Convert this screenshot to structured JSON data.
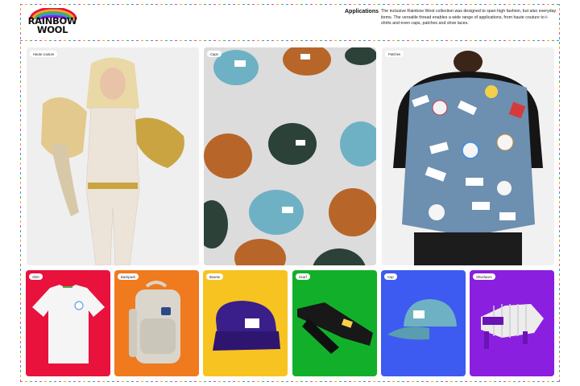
{
  "brand": {
    "line1": "RAINBOW",
    "line2": "WOOL"
  },
  "header": {
    "title": "Applications",
    "description": "The inclusive Rainbow Wool collection was designed to span high fashion, but also everyday items. The versatile thread enables a wide range of applications, from haute couture to t-shirts and even caps, patches and shoe laces."
  },
  "gallery_top": [
    {
      "label": "Haute couture"
    },
    {
      "label": "Caps"
    },
    {
      "label": "Patches"
    }
  ],
  "gallery_bottom": [
    {
      "label": "Shirt"
    },
    {
      "label": "Backpack"
    },
    {
      "label": "Beanie"
    },
    {
      "label": "Scarf"
    },
    {
      "label": "Cap"
    },
    {
      "label": "Shoelaces"
    }
  ],
  "colors": {
    "shirt_bg": "#e8123c",
    "backpack_bg": "#f07a1e",
    "beanie_bg": "#f7c321",
    "scarf_bg": "#12b02a",
    "cap_bg": "#3d5bf0",
    "shoelaces_bg": "#8a1fe0",
    "rainbow": [
      "#e94b8a",
      "#f5a623",
      "#4caf50",
      "#3f8ee8"
    ]
  }
}
